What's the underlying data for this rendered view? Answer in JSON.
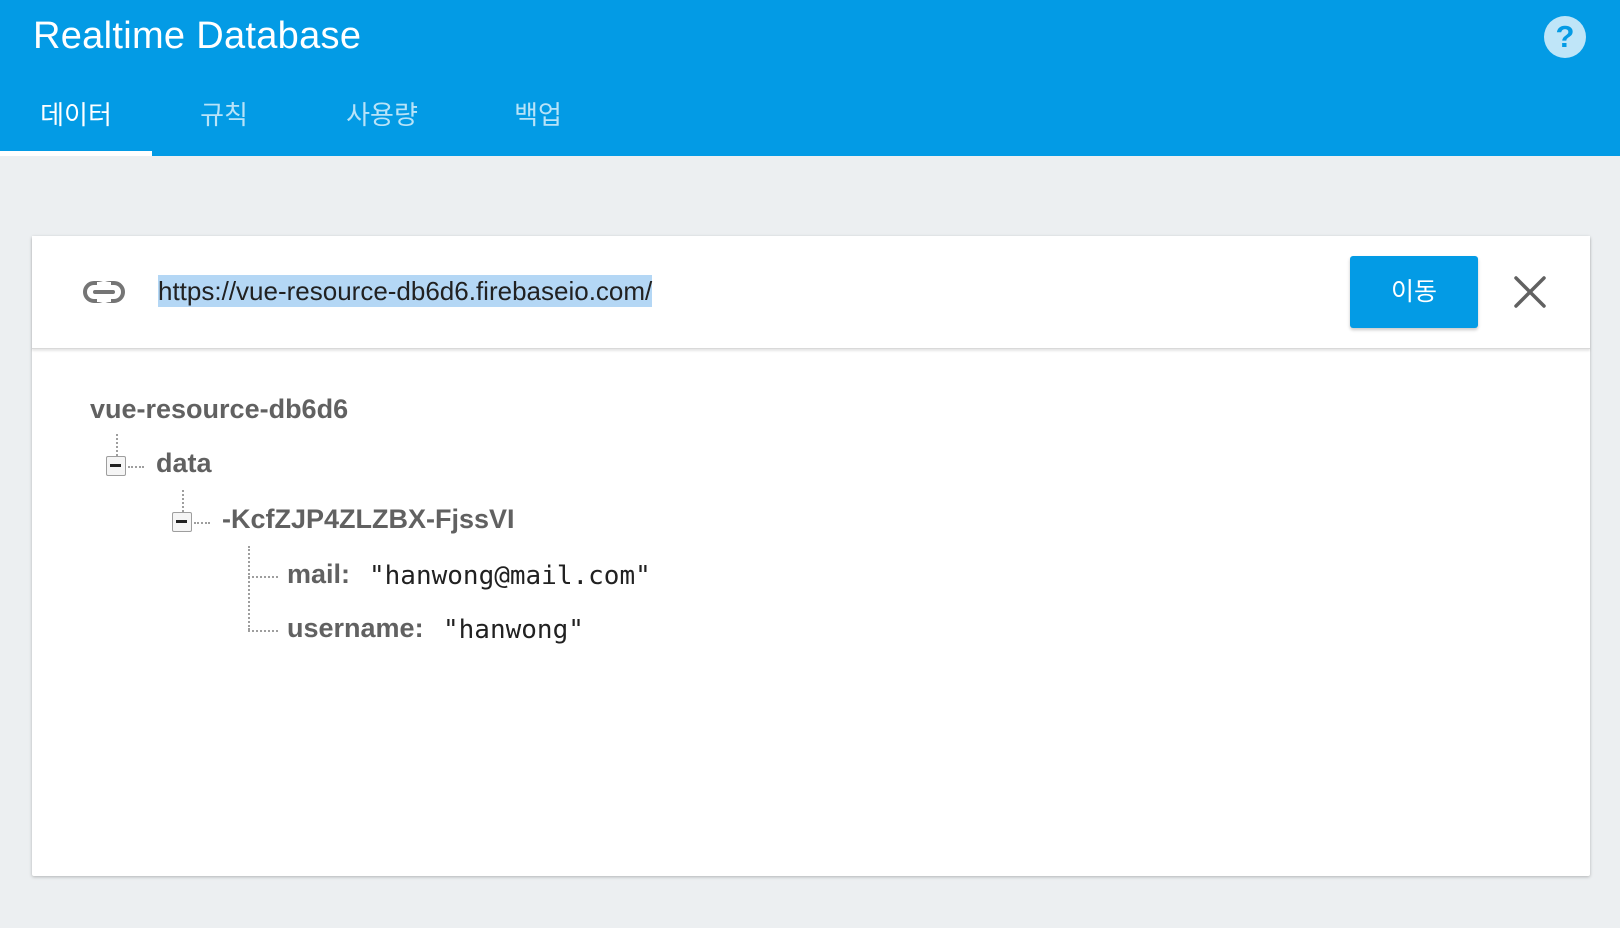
{
  "app": {
    "title": "Realtime Database",
    "help_symbol": "?"
  },
  "tabs": [
    {
      "label": "데이터",
      "active": true
    },
    {
      "label": "규칙",
      "active": false
    },
    {
      "label": "사용량",
      "active": false
    },
    {
      "label": "백업",
      "active": false
    }
  ],
  "url_bar": {
    "value": "https://vue-resource-db6d6.firebaseio.com/",
    "go_label": "이동"
  },
  "tree": {
    "root": "vue-resource-db6d6",
    "child": "data",
    "grandchild": "-KcfZJP4ZLZBX-FjssVI",
    "fields": [
      {
        "key": "mail",
        "value": "\"hanwong@mail.com\""
      },
      {
        "key": "username",
        "value": "\"hanwong\""
      }
    ]
  },
  "colors": {
    "primary": "#039be5",
    "background": "#eceff1",
    "selection": "#b4d7f5"
  },
  "icons": [
    "link-icon",
    "help-icon",
    "close-icon",
    "collapse-icon"
  ]
}
